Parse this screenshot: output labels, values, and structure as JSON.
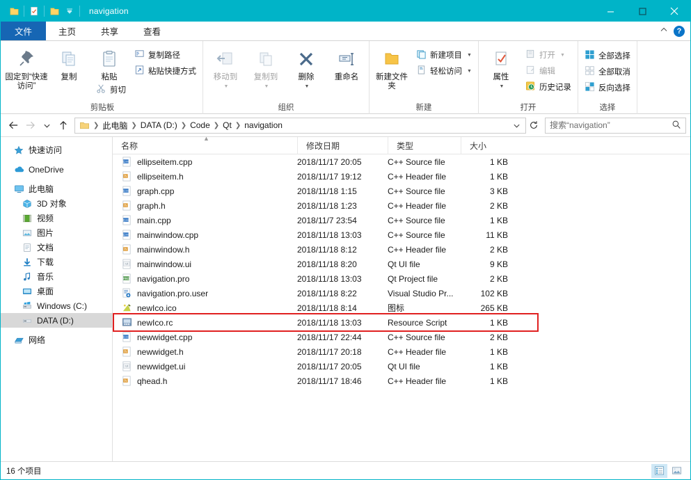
{
  "window": {
    "title": "navigation",
    "quick_access": [
      "folder-icon",
      "properties-icon",
      "new-folder-icon",
      "customize-dropdown-icon"
    ],
    "controls": {
      "minimize": "─",
      "maximize": "□",
      "close": "✕"
    },
    "accent_color": "#00b4c8"
  },
  "tabs": [
    {
      "label": "文件",
      "name": "tab-file"
    },
    {
      "label": "主页",
      "name": "tab-home"
    },
    {
      "label": "共享",
      "name": "tab-share"
    },
    {
      "label": "查看",
      "name": "tab-view"
    }
  ],
  "ribbon": {
    "collapse_icon": "chevron-up-icon",
    "help_icon": "help-icon",
    "groups": [
      {
        "title": "剪贴板",
        "name": "group-clipboard",
        "big": [
          {
            "label": "固定到“快速访问”",
            "icon": "pin-icon",
            "disabled": false
          },
          {
            "label": "复制",
            "icon": "copy-icon",
            "disabled": false
          },
          {
            "label": "粘贴",
            "icon": "paste-icon",
            "disabled": false
          }
        ],
        "small": [
          {
            "label": "复制路径",
            "icon": "copy-path-icon",
            "disabled": false
          },
          {
            "label": "粘贴快捷方式",
            "icon": "paste-shortcut-icon",
            "disabled": false
          }
        ],
        "cut": {
          "label": "剪切",
          "icon": "scissors-icon"
        }
      },
      {
        "title": "组织",
        "name": "group-organize",
        "big": [
          {
            "label": "移动到",
            "icon": "move-to-icon",
            "disabled": true,
            "dropdown": true
          },
          {
            "label": "复制到",
            "icon": "copy-to-icon",
            "disabled": true,
            "dropdown": true
          },
          {
            "label": "删除",
            "icon": "delete-x-icon",
            "disabled": false,
            "dropdown": true
          },
          {
            "label": "重命名",
            "icon": "rename-icon",
            "disabled": false
          }
        ]
      },
      {
        "title": "新建",
        "name": "group-new",
        "big": [
          {
            "label": "新建文件夹",
            "icon": "new-folder-icon",
            "disabled": false
          }
        ],
        "small": [
          {
            "label": "新建项目",
            "icon": "new-item-icon",
            "dropdown": true
          },
          {
            "label": "轻松访问",
            "icon": "easy-access-icon",
            "dropdown": true
          }
        ]
      },
      {
        "title": "打开",
        "name": "group-open",
        "big": [
          {
            "label": "属性",
            "icon": "properties-icon",
            "disabled": false,
            "dropdown": true
          }
        ],
        "small": [
          {
            "label": "打开",
            "icon": "open-icon",
            "disabled": true,
            "dropdown": true
          },
          {
            "label": "编辑",
            "icon": "edit-icon",
            "disabled": true
          },
          {
            "label": "历史记录",
            "icon": "history-icon",
            "disabled": false
          }
        ]
      },
      {
        "title": "选择",
        "name": "group-select",
        "small": [
          {
            "label": "全部选择",
            "icon": "select-all-icon"
          },
          {
            "label": "全部取消",
            "icon": "select-none-icon"
          },
          {
            "label": "反向选择",
            "icon": "invert-selection-icon"
          }
        ]
      }
    ]
  },
  "address": {
    "back_icon": "arrow-left-icon",
    "forward_icon": "arrow-right-icon",
    "recent_icon": "chevron-down-icon",
    "up_icon": "arrow-up-icon",
    "refresh_icon": "refresh-icon",
    "dropdown_icon": "chevron-down-icon",
    "breadcrumbs": [
      "此电脑",
      "DATA (D:)",
      "Code",
      "Qt",
      "navigation"
    ],
    "search_placeholder": "搜索“navigation”",
    "search_value": "",
    "search_icon": "search-icon"
  },
  "navpane": {
    "items": [
      {
        "label": "快速访问",
        "icon": "star-icon",
        "indent": false,
        "selected": false,
        "spaced": false
      },
      {
        "label": "OneDrive",
        "icon": "cloud-icon",
        "indent": false,
        "selected": false,
        "spaced": true
      },
      {
        "label": "此电脑",
        "icon": "monitor-icon",
        "indent": false,
        "selected": false,
        "spaced": true
      },
      {
        "label": "3D 对象",
        "icon": "cube-icon",
        "indent": true,
        "selected": false,
        "spaced": false
      },
      {
        "label": "视频",
        "icon": "video-icon",
        "indent": true,
        "selected": false,
        "spaced": false
      },
      {
        "label": "图片",
        "icon": "picture-icon",
        "indent": true,
        "selected": false,
        "spaced": false
      },
      {
        "label": "文档",
        "icon": "document-icon",
        "indent": true,
        "selected": false,
        "spaced": false
      },
      {
        "label": "下载",
        "icon": "download-icon",
        "indent": true,
        "selected": false,
        "spaced": false
      },
      {
        "label": "音乐",
        "icon": "music-icon",
        "indent": true,
        "selected": false,
        "spaced": false
      },
      {
        "label": "桌面",
        "icon": "desktop-icon",
        "indent": true,
        "selected": false,
        "spaced": false
      },
      {
        "label": "Windows (C:)",
        "icon": "windows-drive-icon",
        "indent": true,
        "selected": false,
        "spaced": false
      },
      {
        "label": "DATA (D:)",
        "icon": "drive-icon",
        "indent": true,
        "selected": true,
        "spaced": false
      },
      {
        "label": "网络",
        "icon": "network-icon",
        "indent": false,
        "selected": false,
        "spaced": true
      }
    ]
  },
  "filelist": {
    "columns": [
      {
        "label": "名称",
        "name": "column-name",
        "sorted": true
      },
      {
        "label": "修改日期",
        "name": "column-date",
        "sorted": false
      },
      {
        "label": "类型",
        "name": "column-type",
        "sorted": false
      },
      {
        "label": "大小",
        "name": "column-size",
        "sorted": false
      }
    ],
    "sort_indicator": "▲",
    "rows": [
      {
        "name": "ellipseitem.cpp",
        "date": "2018/11/17 20:05",
        "type": "C++ Source file",
        "size": "1 KB",
        "icon": "cpp-file-icon",
        "highlighted": false
      },
      {
        "name": "ellipseitem.h",
        "date": "2018/11/17 19:12",
        "type": "C++ Header file",
        "size": "1 KB",
        "icon": "h-file-icon",
        "highlighted": false
      },
      {
        "name": "graph.cpp",
        "date": "2018/11/18 1:15",
        "type": "C++ Source file",
        "size": "3 KB",
        "icon": "cpp-file-icon",
        "highlighted": false
      },
      {
        "name": "graph.h",
        "date": "2018/11/18 1:23",
        "type": "C++ Header file",
        "size": "2 KB",
        "icon": "h-file-icon",
        "highlighted": false
      },
      {
        "name": "main.cpp",
        "date": "2018/11/7 23:54",
        "type": "C++ Source file",
        "size": "1 KB",
        "icon": "cpp-file-icon",
        "highlighted": false
      },
      {
        "name": "mainwindow.cpp",
        "date": "2018/11/18 13:03",
        "type": "C++ Source file",
        "size": "11 KB",
        "icon": "cpp-file-icon",
        "highlighted": false
      },
      {
        "name": "mainwindow.h",
        "date": "2018/11/18 8:12",
        "type": "C++ Header file",
        "size": "2 KB",
        "icon": "h-file-icon",
        "highlighted": false
      },
      {
        "name": "mainwindow.ui",
        "date": "2018/11/18 8:20",
        "type": "Qt UI file",
        "size": "9 KB",
        "icon": "ui-file-icon",
        "highlighted": false
      },
      {
        "name": "navigation.pro",
        "date": "2018/11/18 13:03",
        "type": "Qt Project file",
        "size": "2 KB",
        "icon": "pro-file-icon",
        "highlighted": false
      },
      {
        "name": "navigation.pro.user",
        "date": "2018/11/18 8:22",
        "type": "Visual Studio Pr...",
        "size": "102 KB",
        "icon": "user-file-icon",
        "highlighted": false
      },
      {
        "name": "newIco.ico",
        "date": "2018/11/18 8:14",
        "type": "图标",
        "size": "265 KB",
        "icon": "ico-file-icon",
        "highlighted": false
      },
      {
        "name": "newIco.rc",
        "date": "2018/11/18 13:03",
        "type": "Resource Script",
        "size": "1 KB",
        "icon": "rc-file-icon",
        "highlighted": true
      },
      {
        "name": "newwidget.cpp",
        "date": "2018/11/17 22:44",
        "type": "C++ Source file",
        "size": "2 KB",
        "icon": "cpp-file-icon",
        "highlighted": false
      },
      {
        "name": "newwidget.h",
        "date": "2018/11/17 20:18",
        "type": "C++ Header file",
        "size": "1 KB",
        "icon": "h-file-icon",
        "highlighted": false
      },
      {
        "name": "newwidget.ui",
        "date": "2018/11/17 20:05",
        "type": "Qt UI file",
        "size": "1 KB",
        "icon": "ui-file-icon",
        "highlighted": false
      },
      {
        "name": "qhead.h",
        "date": "2018/11/17 18:46",
        "type": "C++ Header file",
        "size": "1 KB",
        "icon": "h-file-icon",
        "highlighted": false
      }
    ],
    "highlight_color": "#e02020"
  },
  "statusbar": {
    "count_text": "16 个项目",
    "views": [
      {
        "name": "details-view-button",
        "icon": "details-view-icon",
        "active": true
      },
      {
        "name": "large-icons-view-button",
        "icon": "large-icons-view-icon",
        "active": false
      }
    ]
  }
}
